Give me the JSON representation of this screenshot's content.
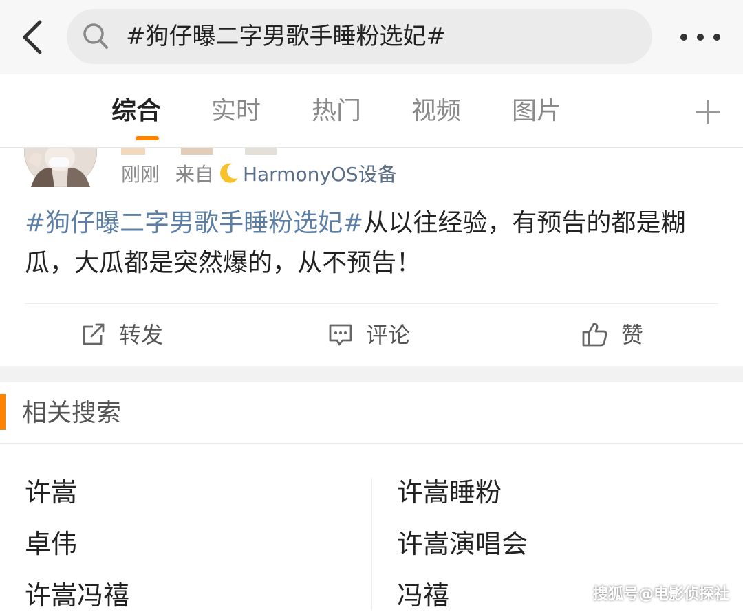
{
  "search": {
    "query": "#狗仔曝二字男歌手睡粉选妃#"
  },
  "tabs": [
    {
      "label": "综合",
      "active": true
    },
    {
      "label": "实时"
    },
    {
      "label": "热门"
    },
    {
      "label": "视频"
    },
    {
      "label": "图片"
    }
  ],
  "post": {
    "time": "刚刚",
    "source_prefix": "来自",
    "device": "HarmonyOS设备",
    "topic": "#狗仔曝二字男歌手睡粉选妃#",
    "text": "从以往经验，有预告的都是糊瓜，大瓜都是突然爆的，从不预告！",
    "actions": {
      "repost": "转发",
      "comment": "评论",
      "like": "赞"
    }
  },
  "related": {
    "title": "相关搜索",
    "left": [
      "许嵩",
      "卓伟",
      "许嵩冯禧"
    ],
    "right": [
      "许嵩睡粉",
      "许嵩演唱会",
      "冯禧"
    ]
  },
  "watermark": "搜狐号@电影侦探社",
  "colors": {
    "accent": "#ff8200",
    "link": "#5e7fa5"
  }
}
